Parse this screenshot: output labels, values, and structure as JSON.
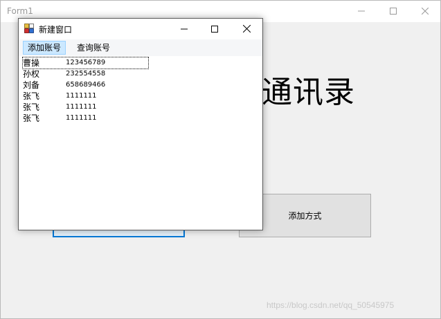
{
  "form1": {
    "title": "Form1",
    "heading": "通讯录",
    "add_button_label": "添加方式"
  },
  "dialog": {
    "title": "新建窗口",
    "menu": [
      {
        "label": "添加账号",
        "active": true
      },
      {
        "label": "查询账号",
        "active": false
      }
    ],
    "rows": [
      {
        "name": "曹操",
        "phone": "123456789"
      },
      {
        "name": "孙权",
        "phone": "232554558"
      },
      {
        "name": "刘备",
        "phone": "658689466"
      },
      {
        "name": "张飞",
        "phone": "1111111"
      },
      {
        "name": "张飞",
        "phone": "1111111"
      },
      {
        "name": "张飞",
        "phone": "1111111"
      }
    ]
  },
  "watermark": "https://blog.csdn.net/qq_50545975",
  "colors": {
    "accent": "#0078d7",
    "menu_active_bg": "#cce8ff",
    "button_bg": "#e1e1e1",
    "form_bg": "#f0f0f0"
  }
}
